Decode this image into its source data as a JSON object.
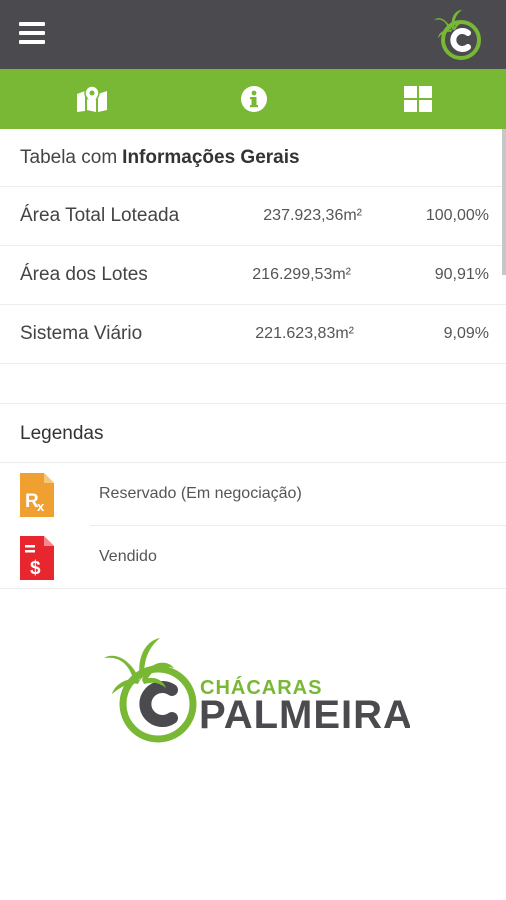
{
  "header": {
    "menu_icon": "hamburger-icon",
    "logo_icon": "chacaras-palmeira-small-logo"
  },
  "tabs": [
    {
      "icon": "map-icon"
    },
    {
      "icon": "info-icon"
    },
    {
      "icon": "grid-icon"
    }
  ],
  "table": {
    "title_prefix": "Tabela com",
    "title_bold": "Informações Gerais",
    "rows": [
      {
        "label": "Área Total Loteada",
        "area": "237.923,36m²",
        "percent": "100,00%"
      },
      {
        "label": "Área dos Lotes",
        "area": "216.299,53m²",
        "percent": "90,91%"
      },
      {
        "label": "Sistema Viário",
        "area": "221.623,83m²",
        "percent": "9,09%"
      }
    ]
  },
  "legend": {
    "title": "Legendas",
    "items": [
      {
        "icon": "reserved-document-icon",
        "label": "Reservado (Em negociação)",
        "color": "#f0a030"
      },
      {
        "icon": "sold-document-icon",
        "label": "Vendido",
        "color": "#e8262e"
      }
    ]
  },
  "brand": {
    "line1": "CHÁCARAS",
    "line2": "PALMEIRA"
  },
  "colors": {
    "header_bg": "#4a4a4f",
    "accent_green": "#78b834",
    "brand_dark": "#4b4b4f"
  }
}
